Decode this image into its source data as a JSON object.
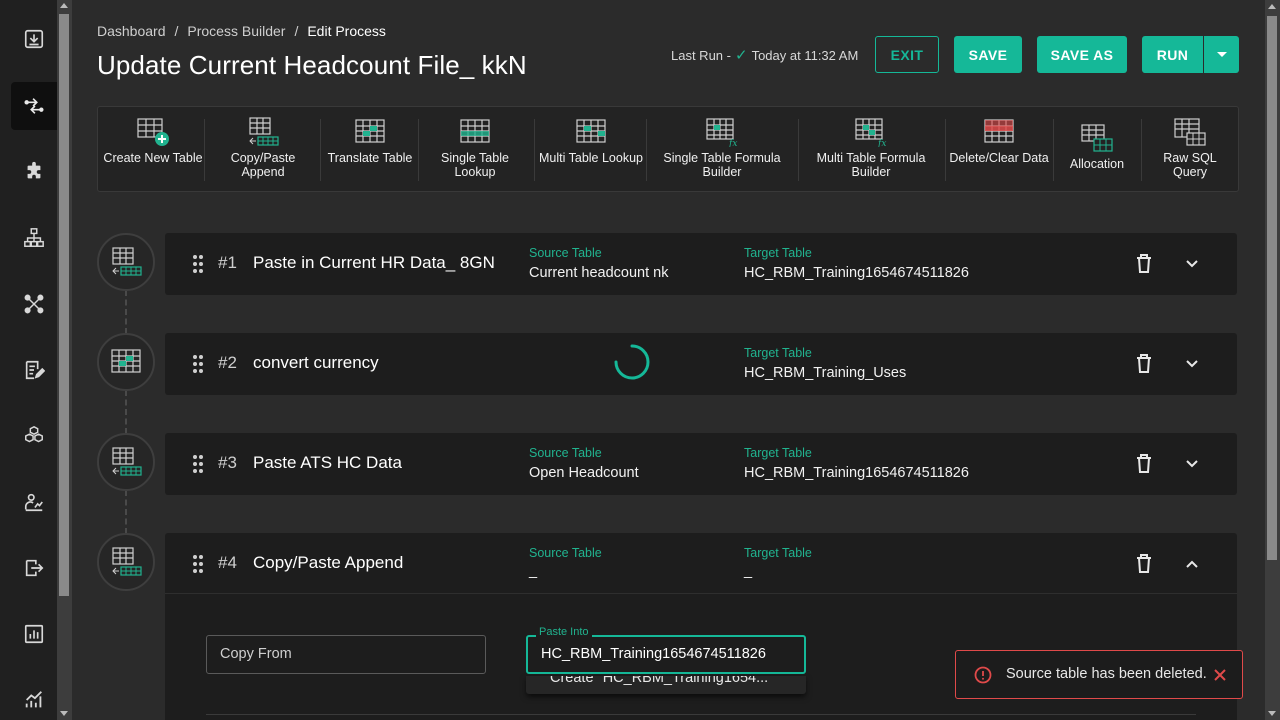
{
  "sidebar": {
    "items": [
      {
        "name": "download-box-icon"
      },
      {
        "name": "process-flow-icon",
        "active": true
      },
      {
        "name": "puzzle-icon"
      },
      {
        "name": "hierarchy-icon"
      },
      {
        "name": "network-icon"
      },
      {
        "name": "edit-report-icon"
      },
      {
        "name": "cubes-icon"
      },
      {
        "name": "user-chart-icon"
      },
      {
        "name": "import-export-icon"
      },
      {
        "name": "bar-chart-icon"
      },
      {
        "name": "trend-chart-icon"
      }
    ]
  },
  "breadcrumb": {
    "items": [
      "Dashboard",
      "Process Builder",
      "Edit Process"
    ],
    "separator": "/"
  },
  "header": {
    "title": "Update Current Headcount File_ kkN",
    "last_run_label": "Last Run -",
    "last_run_value": "Today at 11:32 AM",
    "exit_label": "EXIT",
    "save_label": "SAVE",
    "save_as_label": "SAVE AS",
    "run_label": "RUN"
  },
  "toolbar": {
    "tools": [
      {
        "label": "Create New Table",
        "icon": "create-table-icon"
      },
      {
        "label": "Copy/Paste Append",
        "icon": "copy-paste-append-icon"
      },
      {
        "label": "Translate Table",
        "icon": "translate-table-icon"
      },
      {
        "label": "Single Table Lookup",
        "icon": "single-lookup-icon"
      },
      {
        "label": "Multi Table Lookup",
        "icon": "multi-lookup-icon"
      },
      {
        "label": "Single Table Formula Builder",
        "icon": "single-formula-icon"
      },
      {
        "label": "Multi Table Formula Builder",
        "icon": "multi-formula-icon"
      },
      {
        "label": "Delete/Clear Data",
        "icon": "delete-clear-icon"
      },
      {
        "label": "Allocation",
        "icon": "allocation-icon"
      },
      {
        "label": "Raw SQL Query",
        "icon": "sql-query-icon"
      }
    ]
  },
  "steps": [
    {
      "num": "#1",
      "name": "Paste in Current HR Data_ 8GN",
      "source_label": "Source Table",
      "source": "Current headcount nk",
      "target_label": "Target Table",
      "target": "HC_RBM_Training1654674511826"
    },
    {
      "num": "#2",
      "name": "convert currency",
      "source_label": "",
      "source": "",
      "target_label": "Target Table",
      "target": "HC_RBM_Training_Uses"
    },
    {
      "num": "#3",
      "name": "Paste ATS HC Data",
      "source_label": "Source Table",
      "source": "Open Headcount",
      "target_label": "Target Table",
      "target": "HC_RBM_Training1654674511826"
    },
    {
      "num": "#4",
      "name": "Copy/Paste Append",
      "source_label": "Source Table",
      "source": "_",
      "target_label": "Target Table",
      "target": "_"
    }
  ],
  "step4_body": {
    "copy_from_placeholder": "Copy From",
    "paste_into_label": "Paste Into",
    "paste_into_value": "HC_RBM_Training1654674511826",
    "dropdown_option": "Create \"HC_RBM_Training1654..."
  },
  "toast": {
    "message": "Source table has been deleted.",
    "color": "#e04a4a"
  },
  "colors": {
    "accent": "#15b898",
    "background": "#2b2b2b",
    "card": "#1d1d1d",
    "error": "#e04a4a"
  }
}
